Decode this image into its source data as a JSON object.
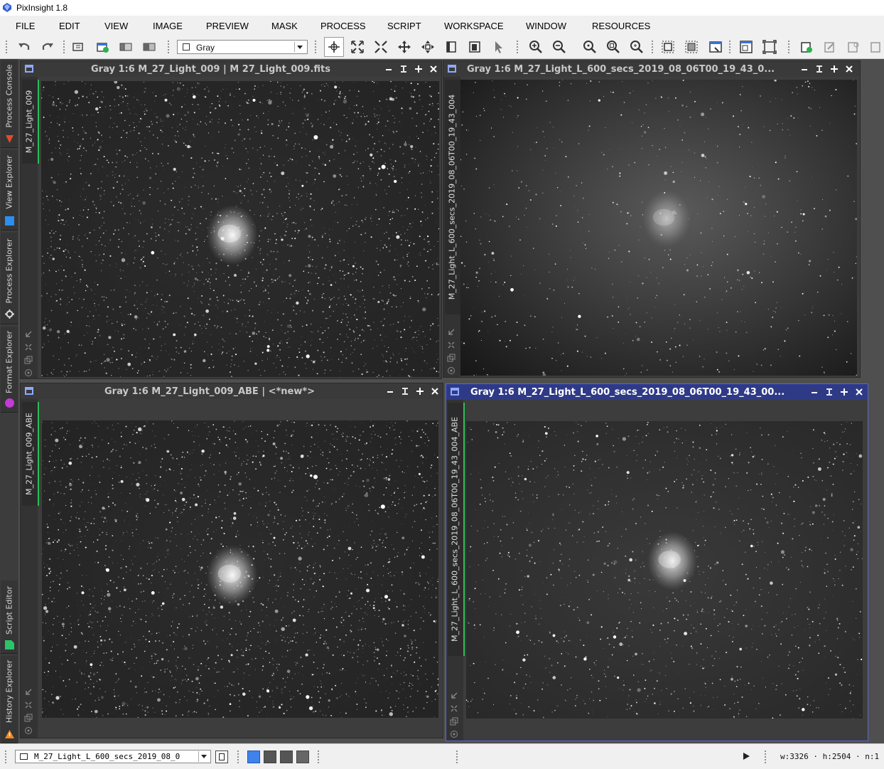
{
  "app": {
    "title": "PixInsight 1.8"
  },
  "menu": [
    "FILE",
    "EDIT",
    "VIEW",
    "IMAGE",
    "PREVIEW",
    "MASK",
    "PROCESS",
    "SCRIPT",
    "WORKSPACE",
    "WINDOW",
    "RESOURCES"
  ],
  "toolbar": {
    "color_mode": "Gray"
  },
  "left_dock": {
    "tabs": [
      "Process Console",
      "View Explorer",
      "Process Explorer",
      "Format Explorer",
      "Script Editor",
      "History Explorer"
    ]
  },
  "windows": [
    {
      "title": "Gray 1:6 M_27_Light_009 | M 27_Light_009.fits",
      "id_tab": "M_27_Light_009",
      "active": false
    },
    {
      "title": "Gray 1:6 M_27_Light_L_600_secs_2019_08_06T00_19_43_0...",
      "id_tab": "M_27_Light_L_600_secs_2019_08_06T00_19_43_004",
      "active": false
    },
    {
      "title": "Gray 1:6 M_27_Light_009_ABE | <*new*>",
      "id_tab": "M_27_Light_009_ABE",
      "active": false
    },
    {
      "title": "Gray 1:6 M_27_Light_L_600_secs_2019_08_06T00_19_43_00...",
      "id_tab": "M_27_Light_L_600_secs_2019_08_06T00_19_43_004_ABE",
      "active": true
    }
  ],
  "status_bar": {
    "view_selector": "M_27_Light_L_600_secs_2019_08_0",
    "info": "w:3326  ·  h:2504  ·  n:1"
  },
  "colors": {
    "active_window_frame": "#2f3a86",
    "view_id_accent": "#2bbf55"
  }
}
